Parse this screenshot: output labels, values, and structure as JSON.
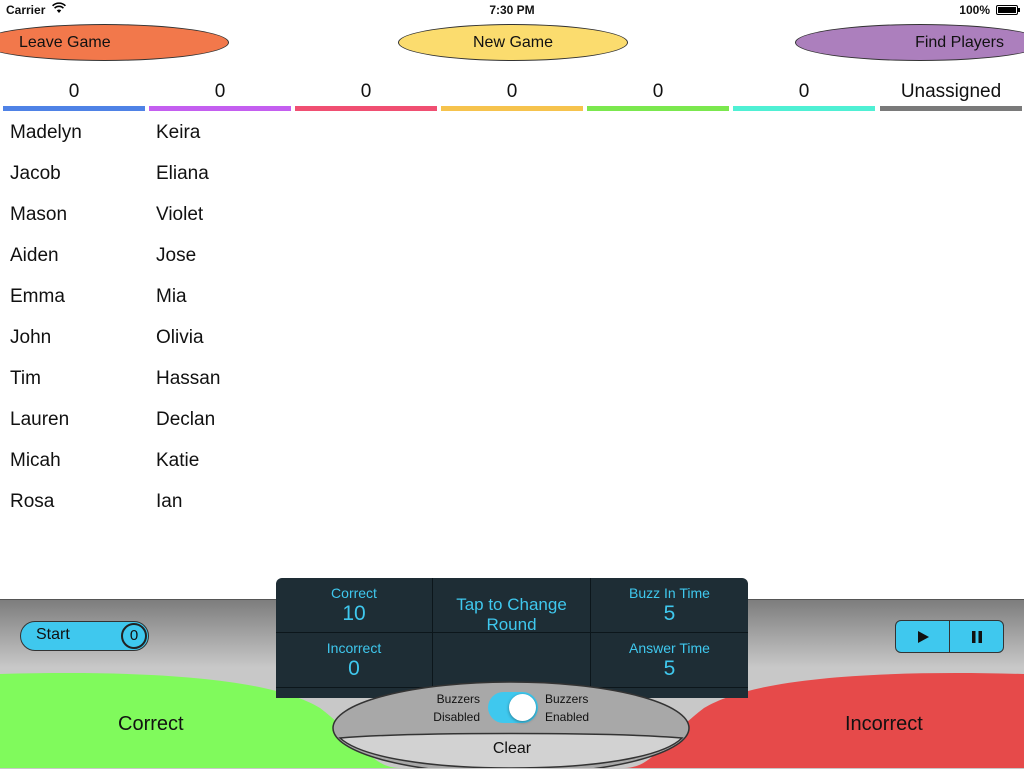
{
  "status": {
    "carrier": "Carrier",
    "time": "7:30 PM",
    "battery": "100%"
  },
  "buttons": {
    "leave_game": "Leave Game",
    "new_game": "New Game",
    "find_players": "Find Players"
  },
  "teams": [
    {
      "score": "0",
      "color": "#4f82e6"
    },
    {
      "score": "0",
      "color": "#c45ff0"
    },
    {
      "score": "0",
      "color": "#f04f72"
    },
    {
      "score": "0",
      "color": "#f6c34d"
    },
    {
      "score": "0",
      "color": "#7be84e"
    },
    {
      "score": "0",
      "color": "#4ff0d4"
    },
    {
      "score": "Unassigned",
      "color": "#7a7a7a"
    }
  ],
  "players": {
    "team1": [
      "Madelyn",
      "Jacob",
      "Mason",
      "Aiden",
      "Emma",
      "John",
      "Tim",
      "Lauren",
      "Micah",
      "Rosa"
    ],
    "team2": [
      "Keira",
      "Eliana",
      "Violet",
      "Jose",
      "Mia",
      "Olivia",
      "Hassan",
      "Declan",
      "Katie",
      "Ian"
    ]
  },
  "controls": {
    "start_label": "Start",
    "start_count": "0",
    "correct_label": "Correct",
    "correct_value": "10",
    "change_round": "Tap to Change Round",
    "buzz_in_label": "Buzz In Time",
    "buzz_in_value": "5",
    "incorrect_label": "Incorrect",
    "incorrect_value": "0",
    "answer_time_label": "Answer Time",
    "answer_time_value": "5",
    "buzzers_disabled": "Buzzers Disabled",
    "buzzers_enabled": "Buzzers Enabled",
    "buzzers_on": true,
    "clear": "Clear",
    "correct_big": "Correct",
    "incorrect_big": "Incorrect",
    "correct_color": "#80fa5c",
    "incorrect_color": "#e64a4a",
    "accent": "#3fc8ee"
  },
  "icons": {
    "play": "play-icon",
    "pause": "pause-icon",
    "wifi": "wifi-icon",
    "battery": "battery-icon"
  }
}
